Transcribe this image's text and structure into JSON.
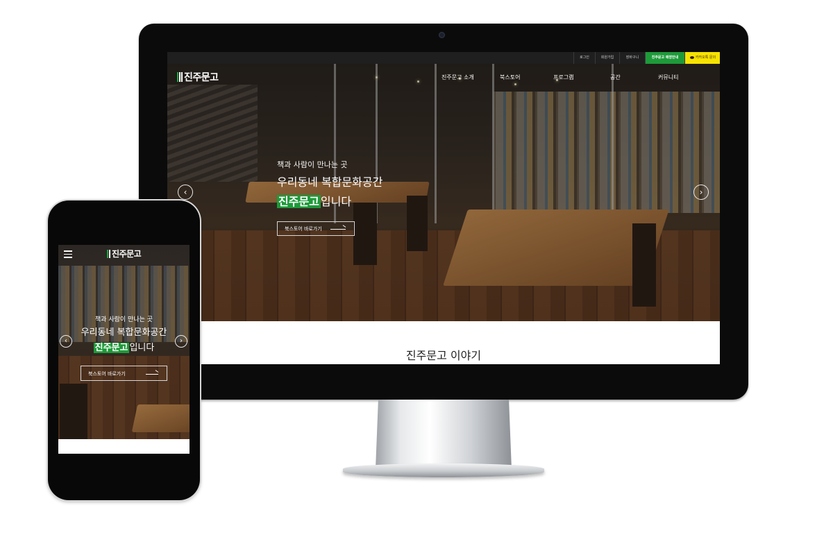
{
  "util_bar": {
    "login": "로그인",
    "signup": "회원가입",
    "cart": "장바구니",
    "guide": "진주문고 매장안내",
    "kakao": "카카오톡 문의"
  },
  "site": {
    "logo_text": "진주문고",
    "logo_accent_color": "#22a548",
    "accent_color": "#1e9a3a"
  },
  "gnb": [
    "진주문고 소개",
    "북스토어",
    "프로그램",
    "공간",
    "커뮤니티"
  ],
  "hero": {
    "line1": "책과 사람이 만나는 곳",
    "line2": "우리동네 복합문화공간",
    "line3_highlight": "진주문고",
    "line3_rest": "입니다",
    "button_label": "북스토어 바로가기",
    "prev_icon": "‹",
    "next_icon": "›"
  },
  "section_title": "진주문고 이야기",
  "mobile": {
    "logo_text": "진주문고",
    "line1": "책과 사람이 만나는 곳",
    "line2": "우리동네 복합문화공간",
    "line3_highlight": "진주문고",
    "line3_rest": "입니다",
    "button_label": "북스토어 바로가기",
    "prev_icon": "‹",
    "next_icon": "›"
  }
}
